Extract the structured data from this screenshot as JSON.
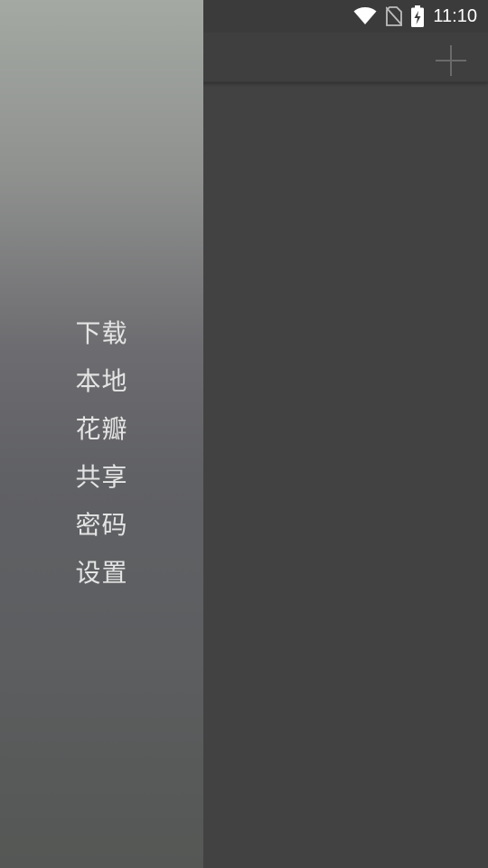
{
  "status_bar": {
    "time": "11:10",
    "icons": [
      "wifi-icon",
      "no-sim-icon",
      "battery-charging-icon"
    ]
  },
  "toolbar": {
    "add_icon": "plus-icon"
  },
  "drawer": {
    "items": [
      {
        "label": "下载"
      },
      {
        "label": "本地"
      },
      {
        "label": "花瓣"
      },
      {
        "label": "共享"
      },
      {
        "label": "密码"
      },
      {
        "label": "设置"
      }
    ]
  },
  "colors": {
    "main_background": "#424242",
    "toolbar": "#3f3f3f",
    "drawer_top": "#a4a9a3",
    "drawer_bottom": "#555755",
    "menu_text": "#e4e4e4"
  }
}
